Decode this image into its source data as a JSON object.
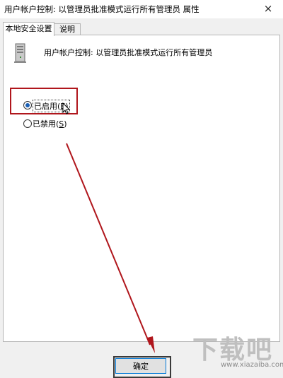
{
  "window": {
    "title": "用户帐户控制: 以管理员批准模式运行所有管理员 属性",
    "close_icon": "×"
  },
  "tabs": [
    {
      "label": "本地安全设置",
      "active": true
    },
    {
      "label": "说明",
      "active": false
    }
  ],
  "policy": {
    "icon": "server-icon",
    "name": "用户帐户控制: 以管理员批准模式运行所有管理员"
  },
  "options": {
    "enabled": {
      "text": "已启用(",
      "key": "E",
      "close": ")",
      "selected": true
    },
    "disabled": {
      "text": "已禁用(",
      "key": "S",
      "close": ")",
      "selected": false
    }
  },
  "buttons": {
    "ok": "确定"
  },
  "annotation": {
    "color": "#b0161c"
  },
  "watermark": {
    "main": "下载吧",
    "sub": "www.xiazaiba.com"
  }
}
